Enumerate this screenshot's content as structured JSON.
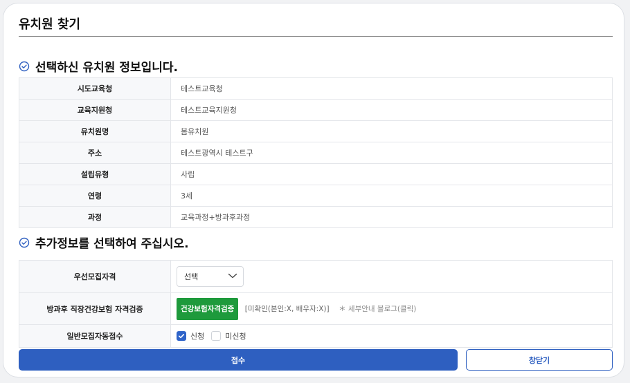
{
  "modal": {
    "title": "유치원 찾기"
  },
  "section1": {
    "heading": "선택하신 유치원 정보입니다.",
    "rows": [
      {
        "label": "시도교육청",
        "value": "테스트교육청"
      },
      {
        "label": "교육지원청",
        "value": "테스트교육지원청"
      },
      {
        "label": "유치원명",
        "value": "봄유치원"
      },
      {
        "label": "주소",
        "value": "테스트광역시 테스트구"
      },
      {
        "label": "설립유형",
        "value": "사립"
      },
      {
        "label": "연령",
        "value": "3세"
      },
      {
        "label": "과정",
        "value": "교육과정+방과후과정"
      }
    ]
  },
  "section2": {
    "heading": "추가정보를 선택하여 주십시오.",
    "priority": {
      "label": "우선모집자격",
      "select_value": "선택"
    },
    "insurance": {
      "label": "방과후 직장건강보험 자격검증",
      "button": "건강보험자격검증",
      "status": "[미확인(본인:X, 배우자:X)]",
      "note": "＊ 세부안내 블로그(클릭)"
    },
    "auto_apply": {
      "label": "일반모집자동접수",
      "options": [
        {
          "label": "신청",
          "checked": true
        },
        {
          "label": "미신청",
          "checked": false
        }
      ]
    }
  },
  "buttons": {
    "submit": "접수",
    "close": "창닫기"
  },
  "colors": {
    "primary": "#2e5fc0",
    "verify_green": "#1e9a3c",
    "checkbox_on": "#2f64c9"
  },
  "icons": {
    "section_icon": "check-circle-icon",
    "select_icon": "chevron-down-icon"
  }
}
